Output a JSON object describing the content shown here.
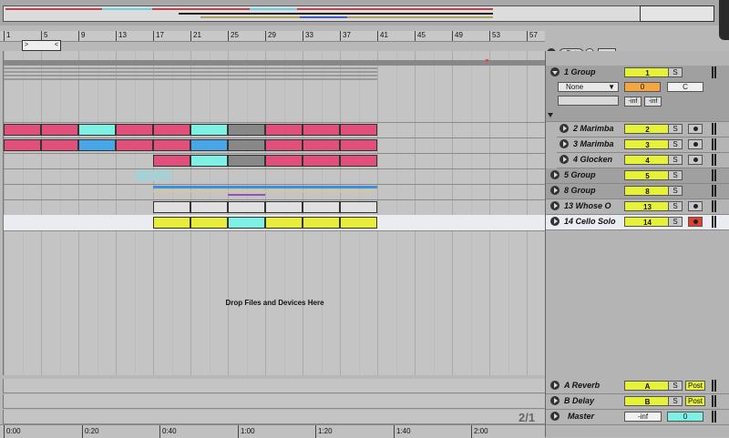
{
  "ruler": {
    "bars": [
      "1",
      "5",
      "9",
      "13",
      "17",
      "21",
      "25",
      "29",
      "33",
      "37",
      "41",
      "45",
      "49",
      "53",
      "57"
    ]
  },
  "loop": {
    "start_marker": ">",
    "end_marker": "<"
  },
  "arrangement": {
    "drop_text": "Drop Files and Devices Here"
  },
  "timeline": {
    "ticks": [
      "0:00",
      "0:20",
      "0:40",
      "1:00",
      "1:20",
      "1:40",
      "2:00"
    ]
  },
  "page_indicator": "2/1",
  "panel": {
    "set_label": "Set",
    "group1": {
      "name": "1 Group",
      "number": "1",
      "solo": "S",
      "input_select": "None",
      "volume": "0",
      "pan": "C",
      "meter_left": "-inf",
      "meter_right": "-inf"
    },
    "tracks": [
      {
        "name": "2 Marimba",
        "number": "2",
        "solo": "S"
      },
      {
        "name": "3 Marimba",
        "number": "3",
        "solo": "S"
      },
      {
        "name": "4 Glocken",
        "number": "4",
        "solo": "S"
      },
      {
        "name": "5 Group",
        "number": "5",
        "solo": "S"
      },
      {
        "name": "8 Group",
        "number": "8",
        "solo": "S"
      },
      {
        "name": "13 Whose O",
        "number": "13",
        "solo": "S"
      },
      {
        "name": "14 Cello Solo",
        "number": "14",
        "solo": "S"
      }
    ],
    "returns": [
      {
        "name": "A Reverb",
        "number": "A",
        "solo": "S",
        "post": "Post"
      },
      {
        "name": "B Delay",
        "number": "B",
        "solo": "S",
        "post": "Post"
      }
    ],
    "master": {
      "name": "Master",
      "volume": "-inf",
      "pan": "0"
    }
  },
  "colors": {
    "pink": "#e0507a",
    "cyan": "#7ef0e4",
    "blue": "#46a6e8",
    "gray": "#888888",
    "yellow": "#e8ec3a",
    "track_yellow": "#e6f23a",
    "orange": "#f4a642",
    "record_red": "#e04030"
  }
}
